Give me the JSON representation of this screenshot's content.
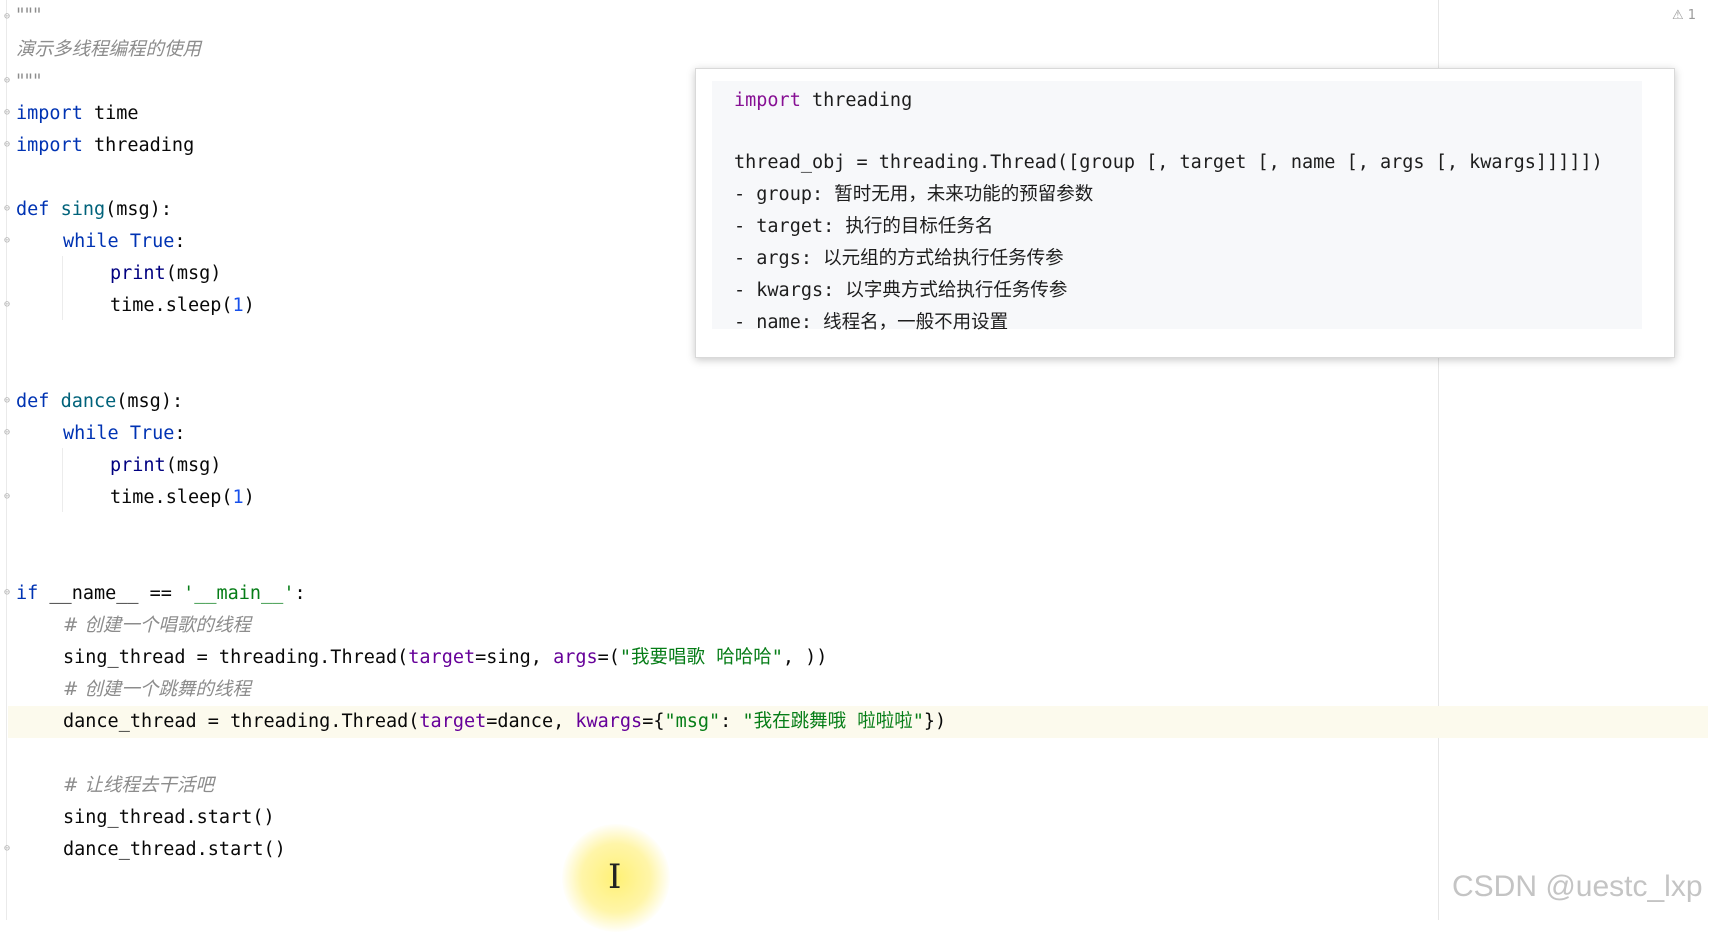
{
  "warning_indicator": "⚠ 1",
  "code": {
    "docstring_open": "\"\"\"",
    "docstring_text": "演示多线程编程的使用",
    "docstring_close": "\"\"\"",
    "import_kw": "import",
    "mod_time": " time",
    "mod_threading": " threading",
    "def_kw": "def",
    "fn_sing": "sing",
    "fn_dance": "dance",
    "params": "(msg):",
    "while_kw": "while",
    "true_kw": "True",
    "colon": ":",
    "print_fn": "print",
    "print_args": "(msg)",
    "sleep_call": "time.sleep(",
    "sleep_num": "1",
    "close_paren": ")",
    "if_kw": "if",
    "main_cond": " __name__ == ",
    "main_str": "'__main__'",
    "comment_sing": "# 创建一个唱歌的线程",
    "sing_assign": "sing_thread = threading.Thread(",
    "target_kw": "target",
    "sing_target_val": "=sing, ",
    "args_kw": "args",
    "args_eq": "=(",
    "sing_str": "\"我要唱歌 哈哈哈\"",
    "sing_tail": ", ))",
    "comment_dance": "# 创建一个跳舞的线程",
    "dance_assign": "dance_thread = threading.Thread(",
    "dance_target_val": "=dance, ",
    "kwargs_kw": "kwargs",
    "kwargs_eq": "={",
    "msg_key": "\"msg\"",
    "kv_sep": ": ",
    "dance_str": "\"我在跳舞哦 啦啦啦\"",
    "dance_tail": "})",
    "comment_work": "# 让线程去干活吧",
    "sing_start": "sing_thread.start()",
    "dance_start": "dance_thread.start()"
  },
  "popup": {
    "import_kw": "import",
    "import_mod": " threading",
    "signature": "thread_obj = threading.Thread([group [, target [, name [, args [, kwargs]]]]])",
    "param_group": "- group: 暂时无用，未来功能的预留参数",
    "param_target": "- target: 执行的目标任务名",
    "param_args": "- args: 以元组的方式给执行任务传参",
    "param_kwargs": "- kwargs: 以字典方式给执行任务传参",
    "param_name": "- name: 线程名，一般不用设置"
  },
  "watermark": "CSDN @uestc_lxp",
  "colors": {
    "keyword": "#0033b3",
    "function": "#00627a",
    "string": "#067d17",
    "number": "#1750eb",
    "param_name": "#660099",
    "comment": "#8c8c8c",
    "popup_keyword": "#871094"
  }
}
